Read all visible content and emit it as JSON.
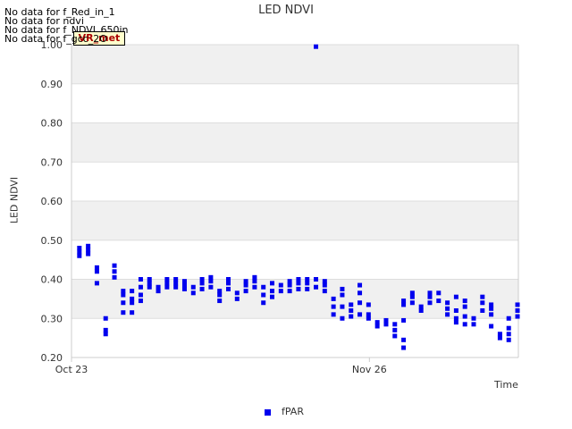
{
  "no_data_messages": [
    "No data for f_Red_in_1",
    "No data for ndvi",
    "No data for f_NDVI_650in",
    "No data for f_gcc_2O"
  ],
  "badge": "VR_met",
  "colors": {
    "series": "#0000ee",
    "band": "#f0f0f0",
    "grid": "#dddddd",
    "axis": "#cccccc"
  },
  "chart_data": {
    "type": "scatter",
    "title": "LED NDVI",
    "xlabel": "Time",
    "ylabel": "LED NDVI",
    "ylim": [
      0.2,
      1.0
    ],
    "x_unit": "date (Oct 23 → end of range)",
    "x_ticks": [
      {
        "label": "Oct 23",
        "day": 0
      },
      {
        "label": "Nov 26",
        "day": 34
      }
    ],
    "xlim_days": [
      0,
      51
    ],
    "y_ticks": [
      "0.20",
      "0.30",
      "0.40",
      "0.50",
      "0.60",
      "0.70",
      "0.80",
      "0.90",
      "1.00"
    ],
    "grid": true,
    "legend": "bottom-center",
    "series": [
      {
        "name": "fPAR",
        "points": [
          [
            0.9,
            0.46
          ],
          [
            0.9,
            0.47
          ],
          [
            0.9,
            0.48
          ],
          [
            1.9,
            0.465
          ],
          [
            1.9,
            0.475
          ],
          [
            1.9,
            0.485
          ],
          [
            2.9,
            0.39
          ],
          [
            2.9,
            0.42
          ],
          [
            2.9,
            0.43
          ],
          [
            3.9,
            0.26
          ],
          [
            3.9,
            0.27
          ],
          [
            3.9,
            0.3
          ],
          [
            4.9,
            0.405
          ],
          [
            4.9,
            0.42
          ],
          [
            4.9,
            0.435
          ],
          [
            5.9,
            0.315
          ],
          [
            5.9,
            0.34
          ],
          [
            5.9,
            0.36
          ],
          [
            5.9,
            0.37
          ],
          [
            6.9,
            0.315
          ],
          [
            6.9,
            0.34
          ],
          [
            6.9,
            0.35
          ],
          [
            6.9,
            0.37
          ],
          [
            7.9,
            0.345
          ],
          [
            7.9,
            0.36
          ],
          [
            7.9,
            0.38
          ],
          [
            7.9,
            0.4
          ],
          [
            8.9,
            0.38
          ],
          [
            8.9,
            0.39
          ],
          [
            8.9,
            0.4
          ],
          [
            9.9,
            0.37
          ],
          [
            9.9,
            0.38
          ],
          [
            10.9,
            0.38
          ],
          [
            10.9,
            0.39
          ],
          [
            10.9,
            0.4
          ],
          [
            11.9,
            0.38
          ],
          [
            11.9,
            0.39
          ],
          [
            11.9,
            0.4
          ],
          [
            12.9,
            0.375
          ],
          [
            12.9,
            0.385
          ],
          [
            12.9,
            0.395
          ],
          [
            13.9,
            0.365
          ],
          [
            13.9,
            0.38
          ],
          [
            14.9,
            0.375
          ],
          [
            14.9,
            0.39
          ],
          [
            14.9,
            0.4
          ],
          [
            15.9,
            0.38
          ],
          [
            15.9,
            0.395
          ],
          [
            15.9,
            0.405
          ],
          [
            16.9,
            0.345
          ],
          [
            16.9,
            0.36
          ],
          [
            16.9,
            0.37
          ],
          [
            17.9,
            0.375
          ],
          [
            17.9,
            0.39
          ],
          [
            17.9,
            0.4
          ],
          [
            18.9,
            0.35
          ],
          [
            18.9,
            0.365
          ],
          [
            19.9,
            0.37
          ],
          [
            19.9,
            0.385
          ],
          [
            19.9,
            0.395
          ],
          [
            20.9,
            0.38
          ],
          [
            20.9,
            0.395
          ],
          [
            20.9,
            0.405
          ],
          [
            21.9,
            0.34
          ],
          [
            21.9,
            0.36
          ],
          [
            21.9,
            0.38
          ],
          [
            22.9,
            0.355
          ],
          [
            22.9,
            0.37
          ],
          [
            22.9,
            0.39
          ],
          [
            23.9,
            0.37
          ],
          [
            23.9,
            0.385
          ],
          [
            24.9,
            0.37
          ],
          [
            24.9,
            0.385
          ],
          [
            24.9,
            0.395
          ],
          [
            25.9,
            0.375
          ],
          [
            25.9,
            0.39
          ],
          [
            25.9,
            0.4
          ],
          [
            26.9,
            0.375
          ],
          [
            26.9,
            0.39
          ],
          [
            26.9,
            0.4
          ],
          [
            27.9,
            0.38
          ],
          [
            27.9,
            0.4
          ],
          [
            27.9,
            0.995
          ],
          [
            28.9,
            0.37
          ],
          [
            28.9,
            0.385
          ],
          [
            28.9,
            0.395
          ],
          [
            29.9,
            0.31
          ],
          [
            29.9,
            0.33
          ],
          [
            29.9,
            0.35
          ],
          [
            30.9,
            0.3
          ],
          [
            30.9,
            0.33
          ],
          [
            30.9,
            0.36
          ],
          [
            30.9,
            0.375
          ],
          [
            31.9,
            0.305
          ],
          [
            31.9,
            0.32
          ],
          [
            31.9,
            0.335
          ],
          [
            32.9,
            0.31
          ],
          [
            32.9,
            0.34
          ],
          [
            32.9,
            0.365
          ],
          [
            32.9,
            0.385
          ],
          [
            33.9,
            0.3
          ],
          [
            33.9,
            0.31
          ],
          [
            33.9,
            0.335
          ],
          [
            34.9,
            0.28
          ],
          [
            34.9,
            0.29
          ],
          [
            35.9,
            0.285
          ],
          [
            35.9,
            0.295
          ],
          [
            36.9,
            0.255
          ],
          [
            36.9,
            0.27
          ],
          [
            36.9,
            0.285
          ],
          [
            37.9,
            0.225
          ],
          [
            37.9,
            0.245
          ],
          [
            37.9,
            0.295
          ],
          [
            37.9,
            0.335
          ],
          [
            37.9,
            0.345
          ],
          [
            38.9,
            0.34
          ],
          [
            38.9,
            0.355
          ],
          [
            38.9,
            0.365
          ],
          [
            39.9,
            0.32
          ],
          [
            39.9,
            0.33
          ],
          [
            40.9,
            0.34
          ],
          [
            40.9,
            0.355
          ],
          [
            40.9,
            0.365
          ],
          [
            41.9,
            0.345
          ],
          [
            41.9,
            0.365
          ],
          [
            42.9,
            0.31
          ],
          [
            42.9,
            0.325
          ],
          [
            42.9,
            0.34
          ],
          [
            43.9,
            0.29
          ],
          [
            43.9,
            0.3
          ],
          [
            43.9,
            0.32
          ],
          [
            43.9,
            0.355
          ],
          [
            44.9,
            0.285
          ],
          [
            44.9,
            0.305
          ],
          [
            44.9,
            0.33
          ],
          [
            44.9,
            0.345
          ],
          [
            45.9,
            0.285
          ],
          [
            45.9,
            0.3
          ],
          [
            46.9,
            0.32
          ],
          [
            46.9,
            0.34
          ],
          [
            46.9,
            0.355
          ],
          [
            47.9,
            0.28
          ],
          [
            47.9,
            0.31
          ],
          [
            47.9,
            0.325
          ],
          [
            47.9,
            0.335
          ],
          [
            48.9,
            0.25
          ],
          [
            48.9,
            0.26
          ],
          [
            49.9,
            0.245
          ],
          [
            49.9,
            0.26
          ],
          [
            49.9,
            0.275
          ],
          [
            49.9,
            0.3
          ],
          [
            50.9,
            0.305
          ],
          [
            50.9,
            0.32
          ],
          [
            50.9,
            0.335
          ]
        ]
      }
    ]
  }
}
